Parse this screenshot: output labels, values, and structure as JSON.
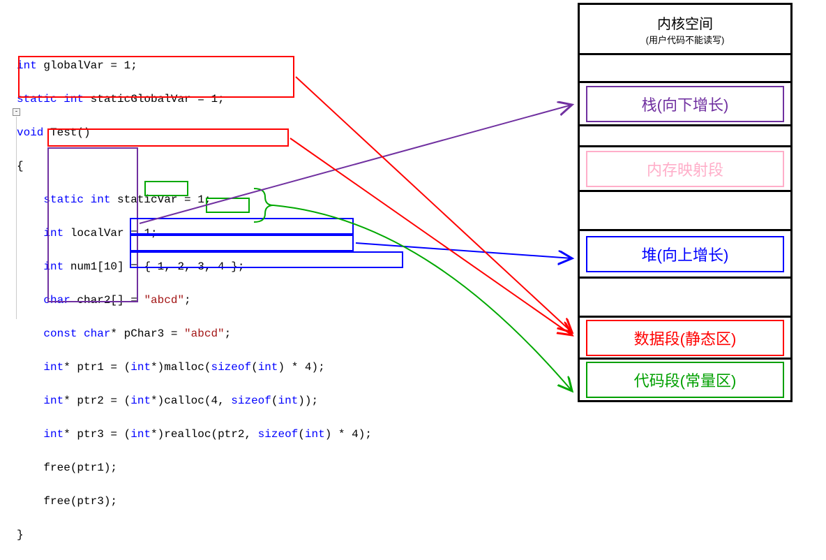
{
  "code": {
    "line1a_kw": "int",
    "line1a_rest": " globalVar = 1;",
    "line2a_kw": "static int",
    "line2a_rest": " staticGlobalVar = 1;",
    "line3_kw": "void",
    "line3_fn": " Test()",
    "line4": "{",
    "line5_kw": "static int",
    "line5_rest": " staticVar = 1;",
    "line6_kw": "int",
    "line6_rest": " localVar = 1;",
    "line7_kw": "int",
    "line7_rest": " num1[10] = { 1, 2, 3, 4 };",
    "line8_kw": "char",
    "line8_mid": " char2[] = ",
    "line8_str": "\"abcd\"",
    "line8_end": ";",
    "line9_kw": "const char",
    "line9_mid": "* pChar3 = ",
    "line9_str": "\"abcd\"",
    "line9_end": ";",
    "line10_kw1": "int",
    "line10_mid1": "* ptr1 = (",
    "line10_kw2": "int",
    "line10_mid2": "*)malloc(",
    "line10_kw3": "sizeof",
    "line10_mid3": "(",
    "line10_kw4": "int",
    "line10_end": ") * 4);",
    "line11_kw1": "int",
    "line11_mid1": "* ptr2 = (",
    "line11_kw2": "int",
    "line11_mid2": "*)calloc(4, ",
    "line11_kw3": "sizeof",
    "line11_mid3": "(",
    "line11_kw4": "int",
    "line11_end": "));",
    "line12_kw1": "int",
    "line12_mid1": "* ptr3 = (",
    "line12_kw2": "int",
    "line12_mid2": "*)realloc(ptr2, ",
    "line12_kw3": "sizeof",
    "line12_mid3": "(",
    "line12_kw4": "int",
    "line12_end": ") * 4);",
    "line13": "free(ptr1);",
    "line14": "free(ptr3);",
    "line15": "}"
  },
  "memory": {
    "kernel_title": "内核空间",
    "kernel_sub": "(用户代码不能读写)",
    "stack": "栈(向下增长)",
    "mmap": "内存映射段",
    "heap": "堆(向上增长)",
    "data": "数据段(静态区)",
    "code": "代码段(常量区)"
  },
  "arrows": [
    {
      "from": "box-purple",
      "to": "stack",
      "color": "#7030A0"
    },
    {
      "from": "box-blue",
      "to": "heap",
      "color": "#0000FF"
    },
    {
      "from": "box-red1",
      "to": "data",
      "color": "#FF0000"
    },
    {
      "from": "box-red2",
      "to": "data",
      "color": "#FF0000"
    },
    {
      "from": "box-green",
      "to": "code",
      "color": "#00A800"
    }
  ]
}
